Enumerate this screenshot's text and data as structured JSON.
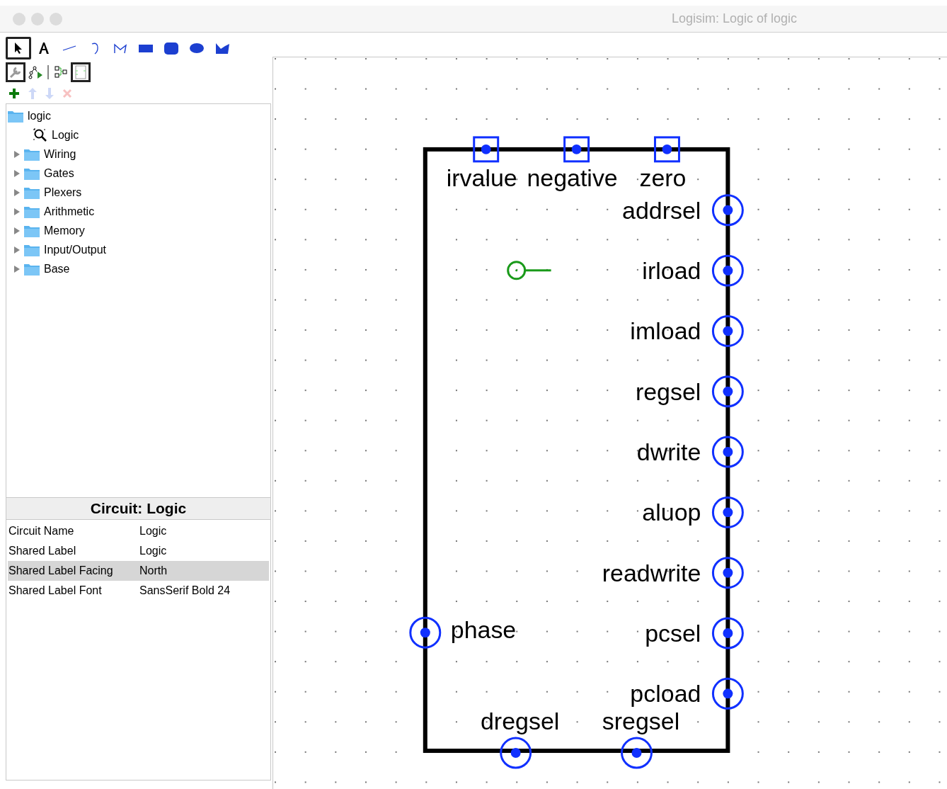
{
  "window": {
    "title": "Logisim: Logic of logic"
  },
  "tools": [
    {
      "kind": "select",
      "selected": true
    },
    {
      "kind": "text",
      "selected": false
    },
    {
      "kind": "line",
      "selected": false
    },
    {
      "kind": "curve",
      "selected": false
    },
    {
      "kind": "polyline",
      "selected": false
    },
    {
      "kind": "rect",
      "selected": false
    },
    {
      "kind": "roundrect",
      "selected": false
    },
    {
      "kind": "oval",
      "selected": false
    },
    {
      "kind": "polygon",
      "selected": false
    }
  ],
  "view_tools": [
    {
      "kind": "edit",
      "selected": true
    },
    {
      "kind": "simulate",
      "selected": false
    },
    {
      "kind": "layout",
      "selected": false
    },
    {
      "kind": "appearance",
      "selected": true
    }
  ],
  "list_tools": [
    {
      "kind": "add",
      "disabled": false
    },
    {
      "kind": "up",
      "disabled": true
    },
    {
      "kind": "down",
      "disabled": true
    },
    {
      "kind": "delete",
      "disabled": true
    }
  ],
  "explorer": [
    {
      "label": "logic",
      "kind": "project",
      "expanded": true,
      "children": [
        {
          "label": "Logic",
          "kind": "circuit"
        },
        {
          "label": "Wiring",
          "kind": "library",
          "expanded": false
        },
        {
          "label": "Gates",
          "kind": "library",
          "expanded": false
        },
        {
          "label": "Plexers",
          "kind": "library",
          "expanded": false
        },
        {
          "label": "Arithmetic",
          "kind": "library",
          "expanded": false
        },
        {
          "label": "Memory",
          "kind": "library",
          "expanded": false
        },
        {
          "label": "Input/Output",
          "kind": "library",
          "expanded": false
        },
        {
          "label": "Base",
          "kind": "library",
          "expanded": false
        }
      ]
    }
  ],
  "properties": {
    "title": "Circuit: Logic",
    "rows": [
      {
        "name": "Circuit Name",
        "value": "Logic",
        "selected": false
      },
      {
        "name": "Shared Label",
        "value": "Logic",
        "selected": false
      },
      {
        "name": "Shared Label Facing",
        "value": "North",
        "selected": true
      },
      {
        "name": "Shared Label Font",
        "value": "SansSerif Bold 24",
        "selected": false
      }
    ]
  },
  "circuit": {
    "top_pins": [
      {
        "label": "irvalue",
        "kind": "input"
      },
      {
        "label": "negative",
        "kind": "input"
      },
      {
        "label": "zero",
        "kind": "input"
      }
    ],
    "right_pins": [
      {
        "label": "addrsel",
        "kind": "output"
      },
      {
        "label": "irload",
        "kind": "output"
      },
      {
        "label": "imload",
        "kind": "output"
      },
      {
        "label": "regsel",
        "kind": "output"
      },
      {
        "label": "dwrite",
        "kind": "output"
      },
      {
        "label": "aluop",
        "kind": "output"
      },
      {
        "label": "readwrite",
        "kind": "output"
      },
      {
        "label": "pcsel",
        "kind": "output"
      },
      {
        "label": "pcload",
        "kind": "output"
      }
    ],
    "left_pins": [
      {
        "label": "phase",
        "kind": "output"
      }
    ],
    "bottom_pins": [
      {
        "label": "dregsel",
        "kind": "output"
      },
      {
        "label": "sregsel",
        "kind": "output"
      }
    ]
  }
}
